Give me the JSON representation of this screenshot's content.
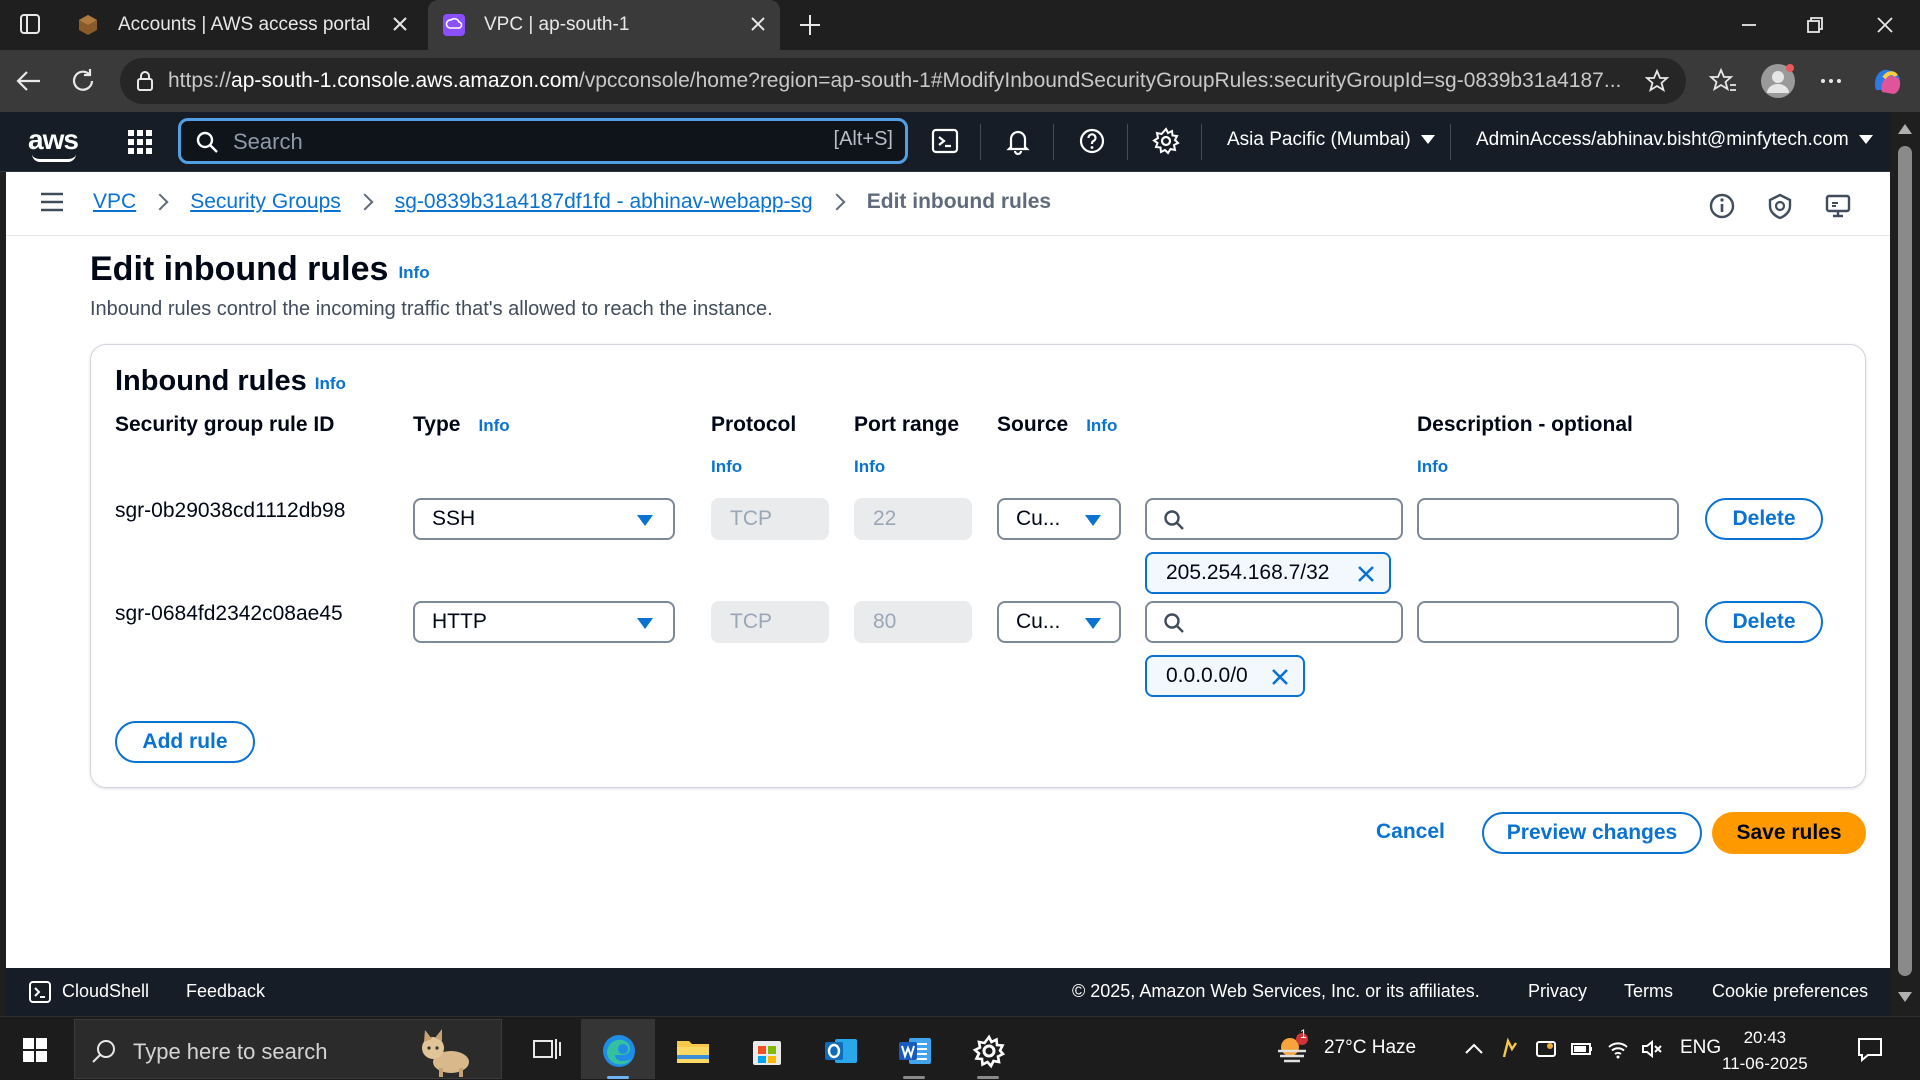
{
  "browser": {
    "tabs": [
      {
        "title": "Accounts | AWS access portal",
        "active": false
      },
      {
        "title": "VPC | ap-south-1",
        "active": true
      }
    ],
    "url_prefix": "https://",
    "url_host": "ap-south-1.console.aws.amazon.com",
    "url_rest": "/vpcconsole/home?region=ap-south-1#ModifyInboundSecurityGroupRules:securityGroupId=sg-0839b31a4187..."
  },
  "aws_header": {
    "logo": "aws",
    "search_placeholder": "Search",
    "search_shortcut": "[Alt+S]",
    "region": "Asia Pacific (Mumbai)",
    "account": "AdminAccess/abhinav.bisht@minfytech.com"
  },
  "breadcrumb": {
    "items": [
      "VPC",
      "Security Groups",
      "sg-0839b31a4187df1fd - abhinav-webapp-sg"
    ],
    "current": "Edit inbound rules"
  },
  "page": {
    "title": "Edit inbound rules",
    "info": "Info",
    "description": "Inbound rules control the incoming traffic that's allowed to reach the instance."
  },
  "panel": {
    "title": "Inbound rules",
    "columns": {
      "rule_id": "Security group rule ID",
      "type": "Type",
      "protocol": "Protocol",
      "port_range": "Port range",
      "source": "Source",
      "description": "Description - optional"
    },
    "rules": [
      {
        "id": "sgr-0b29038cd1112db98",
        "type": "SSH",
        "protocol": "TCP",
        "port": "22",
        "source_type": "Cu...",
        "cidr": "205.254.168.7/32",
        "description": ""
      },
      {
        "id": "sgr-0684fd2342c08ae45",
        "type": "HTTP",
        "protocol": "TCP",
        "port": "80",
        "source_type": "Cu...",
        "cidr": "0.0.0.0/0",
        "description": ""
      }
    ],
    "delete_label": "Delete",
    "add_rule_label": "Add rule"
  },
  "actions": {
    "cancel": "Cancel",
    "preview": "Preview changes",
    "save": "Save rules"
  },
  "footer": {
    "cloudshell": "CloudShell",
    "feedback": "Feedback",
    "copyright": "© 2025, Amazon Web Services, Inc. or its affiliates.",
    "privacy": "Privacy",
    "terms": "Terms",
    "cookies": "Cookie preferences"
  },
  "taskbar": {
    "search_placeholder": "Type here to search",
    "weather": "27°C  Haze",
    "weather_badge": "1",
    "language": "ENG",
    "time": "20:43",
    "date": "11-06-2025"
  },
  "colors": {
    "aws_nav": "#161d26",
    "link": "#0972d3",
    "primary": "#ff9900",
    "search_focus": "#539fe5"
  }
}
